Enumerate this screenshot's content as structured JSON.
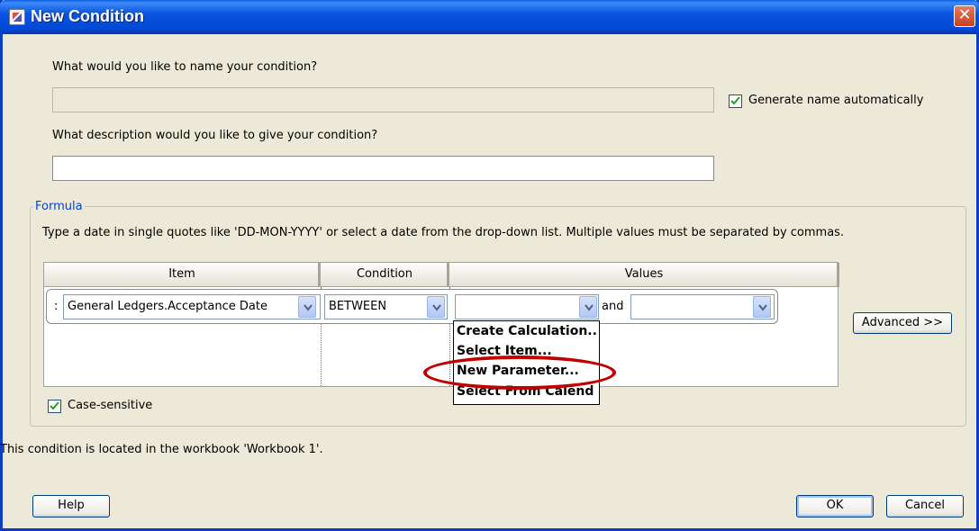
{
  "window": {
    "title": "New Condition"
  },
  "name_section": {
    "prompt": "What would you like to name your condition?",
    "name_value": "",
    "auto_name_label": "Generate name automatically",
    "auto_name_checked": true
  },
  "description_section": {
    "prompt": "What description would you like to give your condition?",
    "description_value": ""
  },
  "formula": {
    "legend": "Formula",
    "hint": "Type a date in single quotes like 'DD-MON-YYYY' or select a date from the drop-down list. Multiple values must be separated by commas.",
    "columns": [
      "Item",
      "Condition",
      "Values"
    ],
    "row": {
      "prefix": ":",
      "item": "General Ledgers.Acceptance Date",
      "condition": "BETWEEN",
      "value1": "",
      "joiner": "and",
      "value2": ""
    },
    "dropdown_menu": [
      "Create Calculation..",
      "Select Item...",
      "New Parameter...",
      "Select From Calend"
    ],
    "highlighted_item": "New Parameter...",
    "advanced_label": "Advanced >>",
    "case_sensitive_label": "Case-sensitive",
    "case_sensitive_checked": true
  },
  "footer": {
    "location_text": "This condition is located in the workbook 'Workbook 1'.",
    "help_label": "Help",
    "ok_label": "OK",
    "cancel_label": "Cancel"
  },
  "colors": {
    "title_bar": "#0954e0",
    "highlight_ring": "#c00000",
    "legend": "#0046d5"
  },
  "icons": [
    "java-cup-icon",
    "close-icon",
    "checkmark-icon",
    "chevron-down-icon"
  ]
}
